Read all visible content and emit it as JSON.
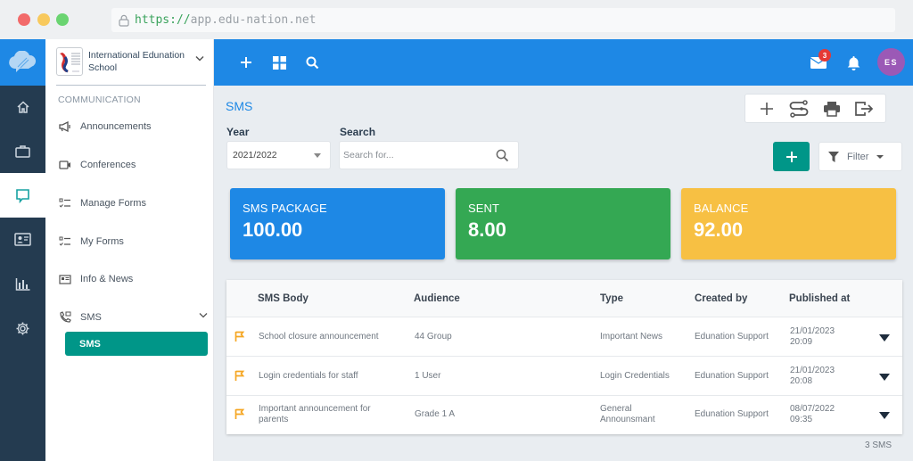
{
  "browser": {
    "url_scheme": "https://",
    "url_host": "app.edu-nation.net"
  },
  "rail": {
    "items": [
      {
        "name": "home",
        "icon": "home-icon"
      },
      {
        "name": "briefcase",
        "icon": "briefcase-icon"
      },
      {
        "name": "communication",
        "icon": "chat-icon",
        "active": true
      },
      {
        "name": "id-card",
        "icon": "id-card-icon"
      },
      {
        "name": "reports",
        "icon": "bar-chart-icon"
      },
      {
        "name": "settings",
        "icon": "gear-icon"
      }
    ]
  },
  "sidebar": {
    "school_name": "International Edunation School",
    "section": "COMMUNICATION",
    "items": [
      {
        "label": "Announcements",
        "icon": "megaphone-icon"
      },
      {
        "label": "Conferences",
        "icon": "video-icon"
      },
      {
        "label": "Manage Forms",
        "icon": "checklist-icon"
      },
      {
        "label": "My Forms",
        "icon": "checklist-icon"
      },
      {
        "label": "Info & News",
        "icon": "news-icon"
      },
      {
        "label": "SMS",
        "icon": "phone-message-icon",
        "expanded": true
      }
    ],
    "sub_items": [
      {
        "label": "SMS",
        "active": true
      }
    ]
  },
  "topbar": {
    "mail_badge": "3",
    "avatar_initials": "ES"
  },
  "page": {
    "title": "SMS",
    "year_label": "Year",
    "year_value": "2021/2022",
    "search_label": "Search",
    "search_placeholder": "Search for...",
    "filter_label": "Filter"
  },
  "cards": [
    {
      "label": "SMS PACKAGE",
      "value": "100.00",
      "color": "#1e88e5"
    },
    {
      "label": "SENT",
      "value": "8.00",
      "color": "#34a853"
    },
    {
      "label": "BALANCE",
      "value": "92.00",
      "color": "#f7c043"
    }
  ],
  "table": {
    "columns": [
      "SMS Body",
      "Audience",
      "Type",
      "Created by",
      "Published at"
    ],
    "rows": [
      {
        "body": "School closure announcement",
        "audience": "44 Group",
        "type": "Important News",
        "created_by": "Edunation Support",
        "date": "21/01/2023",
        "time": "20:09"
      },
      {
        "body": "Login credentials for staff",
        "audience": "1 User",
        "type": "Login Credentials",
        "created_by": "Edunation Support",
        "date": "21/01/2023",
        "time": "20:08"
      },
      {
        "body": "Important announcement for parents",
        "audience": "Grade 1 A",
        "type": "General Announsmant",
        "created_by": "Edunation Support",
        "date": "08/07/2022",
        "time": "09:35"
      }
    ],
    "count_label": "3 SMS"
  },
  "colors": {
    "primary": "#1e88e5",
    "teal": "#009688",
    "rail": "#243b50",
    "flag": "#f5a623"
  }
}
